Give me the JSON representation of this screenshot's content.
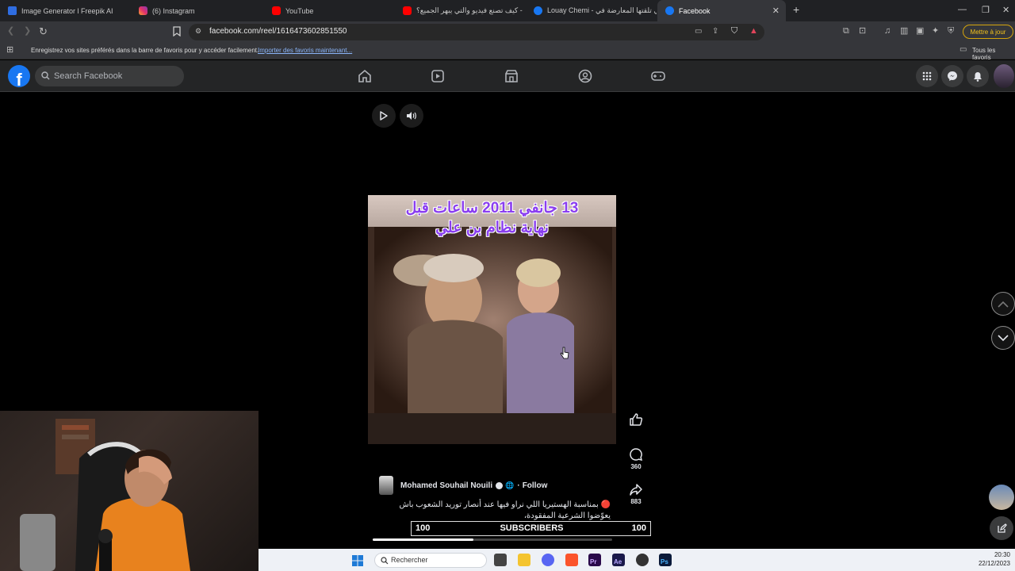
{
  "browser": {
    "tabs": [
      {
        "label": "Image Generator l Freepik AI",
        "icon": "freepik-icon",
        "active": false
      },
      {
        "label": "(6) Instagram",
        "icon": "instagram-icon",
        "active": false
      },
      {
        "label": "YouTube",
        "icon": "youtube-icon",
        "active": false
      },
      {
        "label": "كيف تصنع فيديو والتي يبهر الجميع؟ -",
        "icon": "youtube-icon",
        "active": false
      },
      {
        "label": "Louay Chemi - تي تلقتها المعارضة في",
        "icon": "facebook-icon",
        "active": false
      },
      {
        "label": "Facebook",
        "icon": "facebook-icon",
        "active": true
      }
    ],
    "url": "facebook.com/reel/1616473602851550",
    "update_button": "Mettre à jour",
    "bookmark_prompt": "Enregistrez vos sites préférés dans la barre de favoris pour y accéder facilement.",
    "bookmark_link": "Importer des favoris maintenant...",
    "all_bookmarks": "Tous les favoris"
  },
  "facebook": {
    "search_placeholder": "Search Facebook",
    "nav_icons": [
      "home-icon",
      "video-icon",
      "marketplace-icon",
      "groups-icon",
      "gaming-icon"
    ],
    "right_icons": [
      "menu-grid-icon",
      "messenger-icon",
      "notifications-icon",
      "profile-avatar"
    ]
  },
  "reel": {
    "video_caption_line1": "13 جانفي 2011 ساعات قبل",
    "video_caption_line2": "نهاية نظام بن علي",
    "likes_label": "",
    "comments_count": "360",
    "shares_count": "883",
    "author": "Mohamed Souhail Nouili",
    "follow_label": "Follow",
    "separator": "·",
    "description": "🔴 بمناسبة الهستيريا اللي نراو فيها عند أنصار توريد الشعوب باش يعوّضوا الشرعية المفقودة،",
    "subscribers_left": "100",
    "subscribers_label": "SUBSCRIBERS",
    "subscribers_right": "100",
    "progress": 0.42
  },
  "taskbar": {
    "search_label": "Rechercher",
    "time": "20:30",
    "date": "22/12/2023"
  },
  "colors": {
    "fb_blue": "#1877f2",
    "caption_purple": "#8a3ef0",
    "update_yellow": "#f3c21a"
  }
}
